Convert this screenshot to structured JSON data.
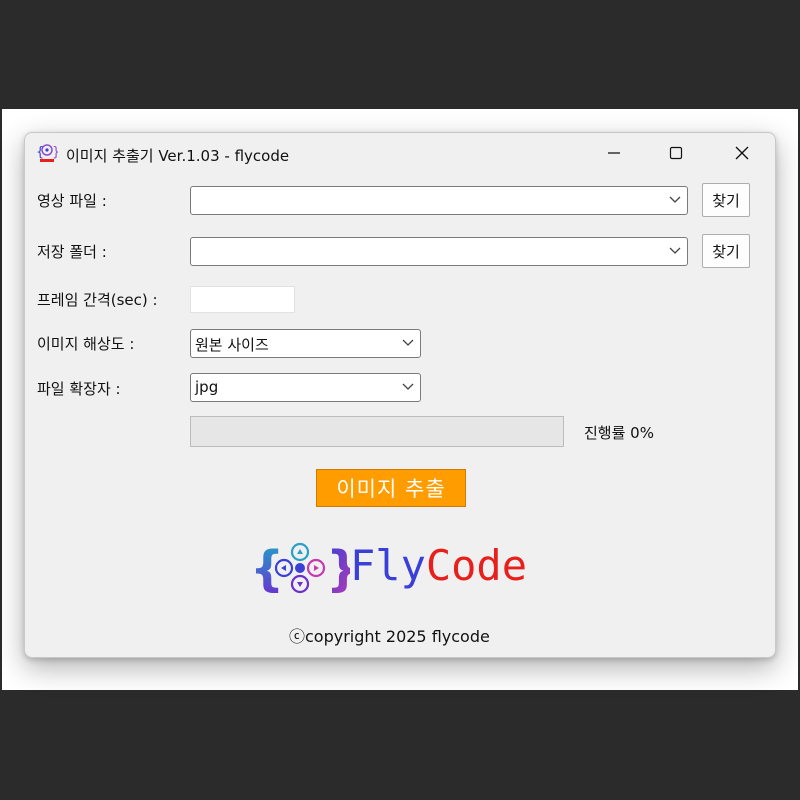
{
  "window": {
    "title": "이미지 추출기 Ver.1.03 - flycode",
    "app_icon": "flycode-logo-icon",
    "controls": [
      "minimize-icon",
      "maximize-icon",
      "close-icon"
    ]
  },
  "form": {
    "video_file": {
      "label": "영상 파일 :",
      "value": "",
      "button": "찾기"
    },
    "save_folder": {
      "label": "저장 폴더 :",
      "value": "",
      "button": "찾기"
    },
    "frame_interval": {
      "label": "프레임 간격(sec) :",
      "value": ""
    },
    "resolution": {
      "label": "이미지 해상도 :",
      "selected": "원본 사이즈"
    },
    "extension": {
      "label": "파일 확장자 :",
      "selected": "jpg"
    }
  },
  "progress": {
    "text": "진행률 0%",
    "percent": 0
  },
  "extract_button": "이미지 추출",
  "logo": {
    "fly": "Fly",
    "code": "Code"
  },
  "copyright": "ⓒcopyright 2025 flycode",
  "colors": {
    "extract_button": "#ff9c00",
    "logo_fly": "#3a3fd8",
    "logo_code": "#e8201c",
    "window_bg": "#f0f0f0"
  }
}
